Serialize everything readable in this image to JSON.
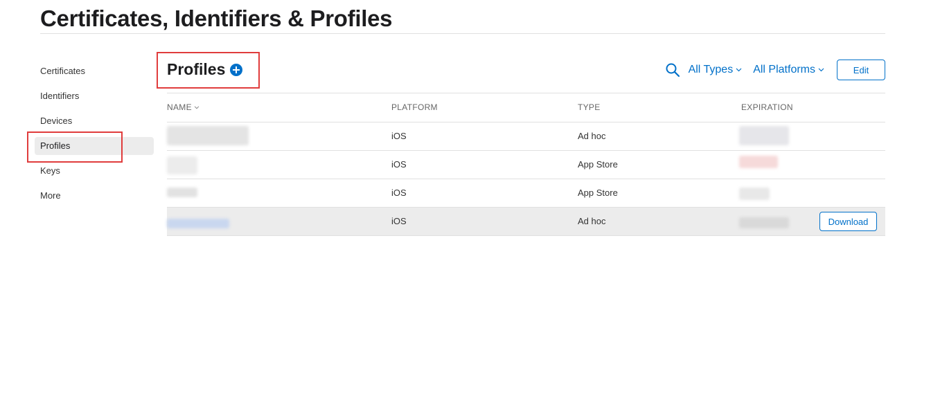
{
  "header": {
    "title": "Certificates, Identifiers & Profiles"
  },
  "sidebar": {
    "items": [
      {
        "label": "Certificates"
      },
      {
        "label": "Identifiers"
      },
      {
        "label": "Devices"
      },
      {
        "label": "Profiles",
        "active": true
      },
      {
        "label": "Keys"
      },
      {
        "label": "More"
      }
    ]
  },
  "main": {
    "section_title": "Profiles",
    "add_icon": "plus-circle-icon",
    "search_icon": "search-icon",
    "filters": {
      "types": "All Types",
      "platforms": "All Platforms"
    },
    "edit_label": "Edit"
  },
  "table": {
    "columns": [
      "NAME",
      "PLATFORM",
      "TYPE",
      "EXPIRATION"
    ],
    "sort_icon": "chevron-down-icon",
    "rows": [
      {
        "name": "",
        "platform": "iOS",
        "type": "Ad hoc",
        "expiration": ""
      },
      {
        "name": "",
        "platform": "iOS",
        "type": "App Store",
        "expiration": ""
      },
      {
        "name": "",
        "platform": "iOS",
        "type": "App Store",
        "expiration": ""
      },
      {
        "name": "",
        "platform": "iOS",
        "type": "Ad hoc",
        "expiration": "",
        "download_label": "Download"
      }
    ]
  },
  "colors": {
    "accent": "#0070c9",
    "annotation": "#e03c3c",
    "active_bg": "#ececec"
  }
}
